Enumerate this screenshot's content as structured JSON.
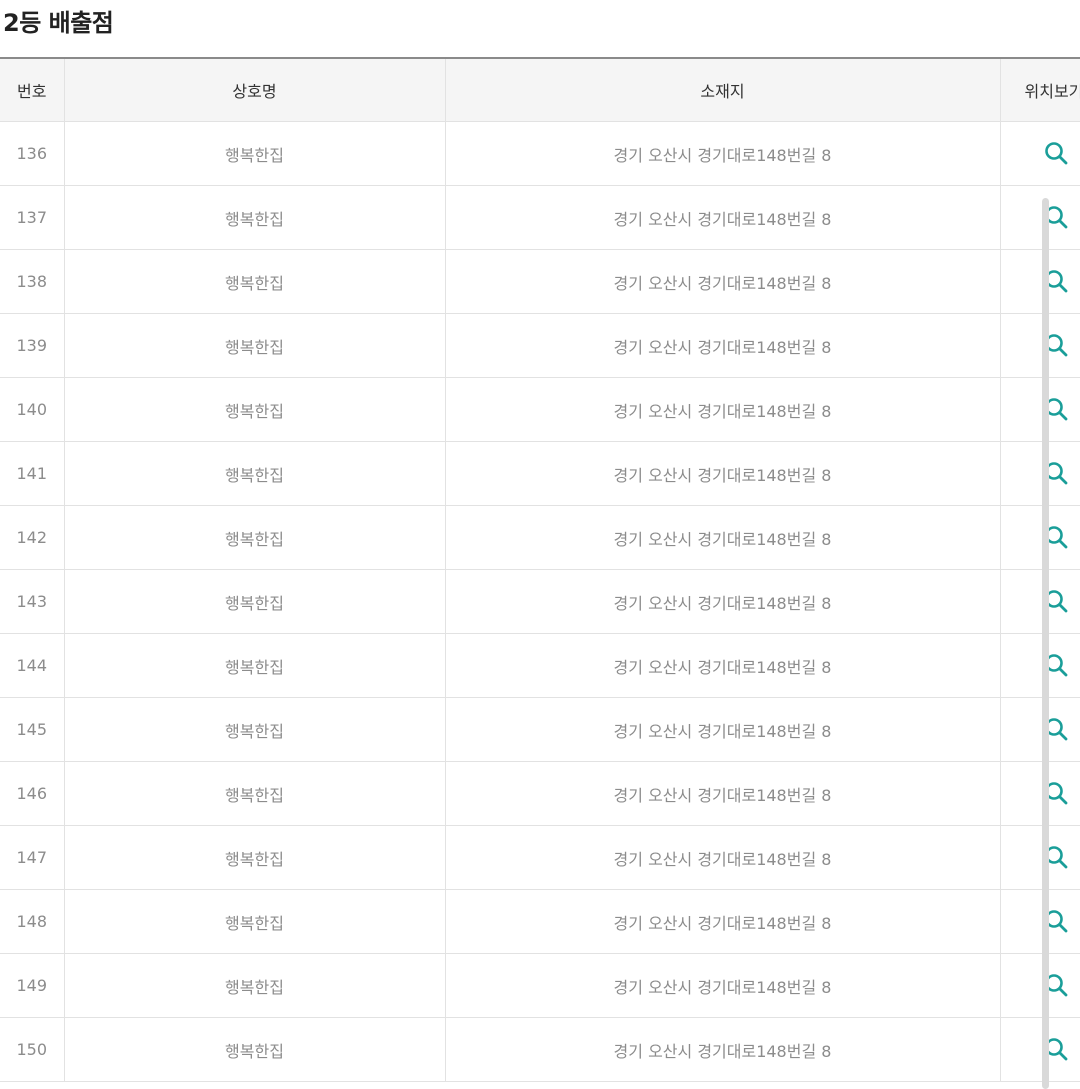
{
  "page": {
    "title": "2등 배출점"
  },
  "table": {
    "headers": {
      "number": "번호",
      "store_name": "상호명",
      "address": "소재지",
      "location": "위치보기"
    },
    "rows": [
      {
        "number": "136",
        "store_name": "행복한집",
        "address": "경기 오산시 경기대로148번길 8"
      },
      {
        "number": "137",
        "store_name": "행복한집",
        "address": "경기 오산시 경기대로148번길 8"
      },
      {
        "number": "138",
        "store_name": "행복한집",
        "address": "경기 오산시 경기대로148번길 8"
      },
      {
        "number": "139",
        "store_name": "행복한집",
        "address": "경기 오산시 경기대로148번길 8"
      },
      {
        "number": "140",
        "store_name": "행복한집",
        "address": "경기 오산시 경기대로148번길 8"
      },
      {
        "number": "141",
        "store_name": "행복한집",
        "address": "경기 오산시 경기대로148번길 8"
      },
      {
        "number": "142",
        "store_name": "행복한집",
        "address": "경기 오산시 경기대로148번길 8"
      },
      {
        "number": "143",
        "store_name": "행복한집",
        "address": "경기 오산시 경기대로148번길 8"
      },
      {
        "number": "144",
        "store_name": "행복한집",
        "address": "경기 오산시 경기대로148번길 8"
      },
      {
        "number": "145",
        "store_name": "행복한집",
        "address": "경기 오산시 경기대로148번길 8"
      },
      {
        "number": "146",
        "store_name": "행복한집",
        "address": "경기 오산시 경기대로148번길 8"
      },
      {
        "number": "147",
        "store_name": "행복한집",
        "address": "경기 오산시 경기대로148번길 8"
      },
      {
        "number": "148",
        "store_name": "행복한집",
        "address": "경기 오산시 경기대로148번길 8"
      },
      {
        "number": "149",
        "store_name": "행복한집",
        "address": "경기 오산시 경기대로148번길 8"
      },
      {
        "number": "150",
        "store_name": "행복한집",
        "address": "경기 오산시 경기대로148번길 8"
      }
    ],
    "location_icon": "search-icon"
  },
  "colors": {
    "accent": "#1a9e99",
    "header_bg": "#f5f5f5",
    "cell_text": "#8c8c8c",
    "grid_line": "#e2e2e2",
    "scrollbar": "#d9d9d9"
  }
}
